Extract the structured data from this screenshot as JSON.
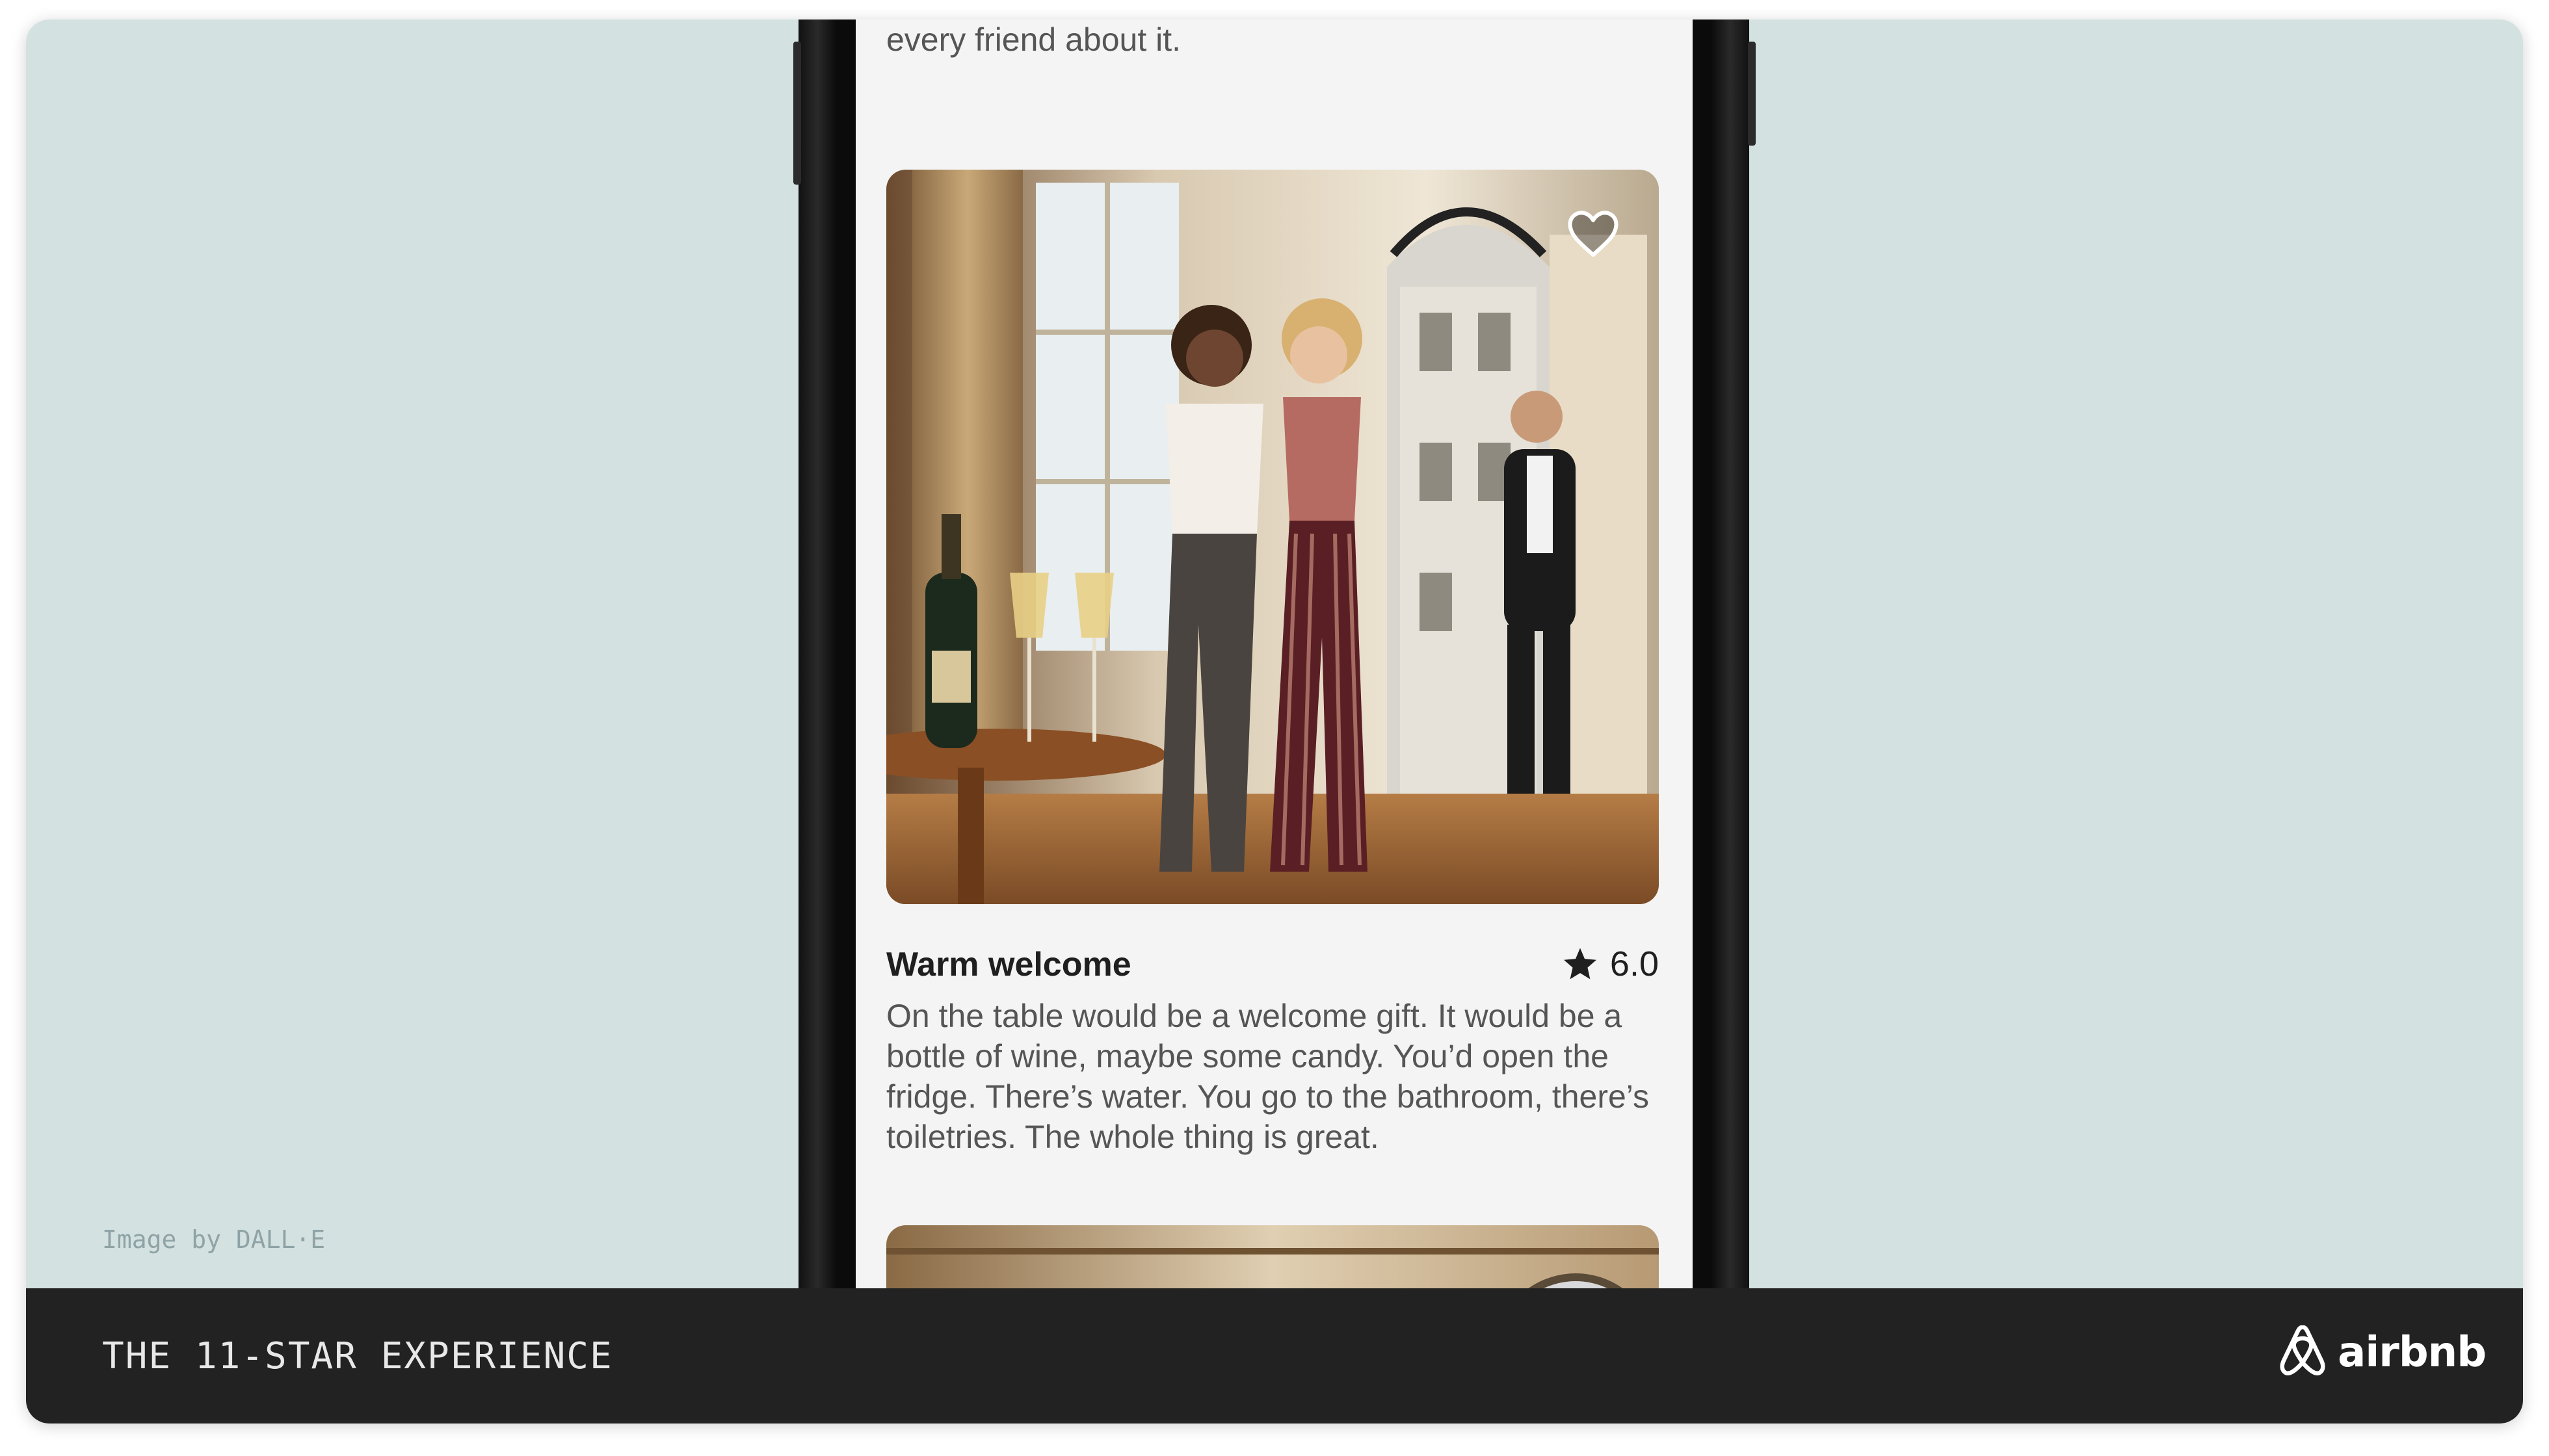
{
  "slide": {
    "footer_title": "THE 11-STAR EXPERIENCE",
    "image_credit": "Image by DALL·E",
    "logo_text": "airbnb",
    "logo_icon": "airbnb-belo-icon",
    "background_color": "#d4e1e1",
    "footer_color": "#222222"
  },
  "phone": {
    "top_text": "every friend about it.",
    "cards": [
      {
        "title": "Warm welcome",
        "rating": "6.0",
        "rating_icon": "star-icon",
        "favorite_icon": "heart-outline-icon",
        "description": "On the table would be a welcome gift. It would be a bottle of wine, maybe some candy. You’d open the fridge. There’s water. You go to the bathroom, there’s toiletries. The whole thing is great."
      }
    ]
  }
}
